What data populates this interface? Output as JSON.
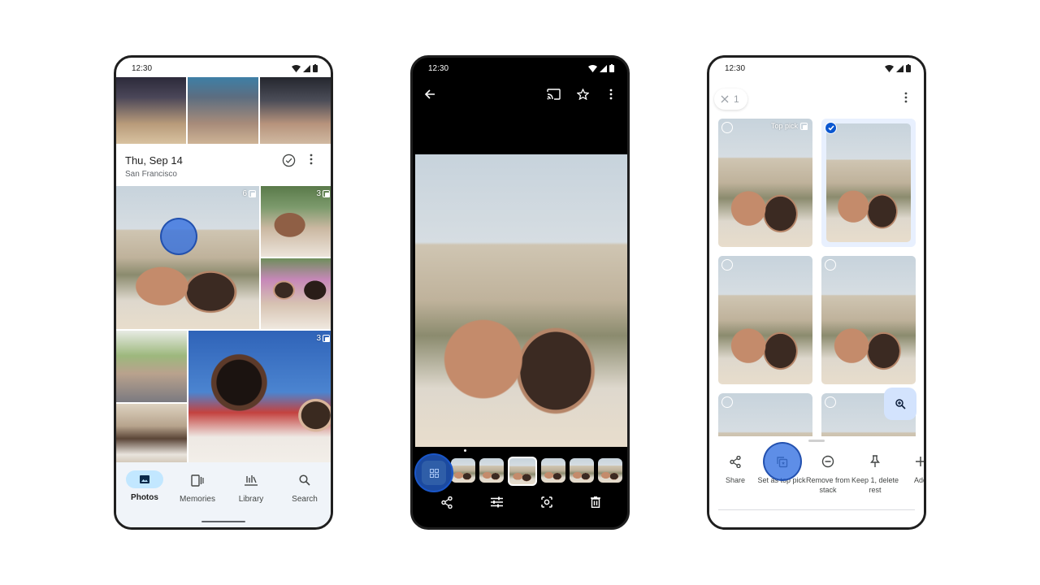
{
  "status_bar": {
    "time": "12:30"
  },
  "phone1": {
    "date_header": {
      "date": "Thu, Sep 14",
      "location": "San Francisco"
    },
    "stack_badges": [
      {
        "count": "6"
      },
      {
        "count": "3"
      },
      {
        "count": "3"
      }
    ],
    "bottom_nav": [
      {
        "label": "Photos",
        "icon": "photos-icon",
        "active": true
      },
      {
        "label": "Memories",
        "icon": "memories-icon",
        "active": false
      },
      {
        "label": "Library",
        "icon": "library-icon",
        "active": false
      },
      {
        "label": "Search",
        "icon": "search-icon",
        "active": false
      }
    ]
  },
  "phone2": {
    "top_actions": [
      "back-arrow-icon",
      "cast-icon",
      "star-icon",
      "more-vert-icon"
    ],
    "stack_thumbnails": 6,
    "current_thumbnail_index": 3,
    "bottom_actions": [
      "share-icon",
      "edit-adjust-icon",
      "lens-icon",
      "delete-icon"
    ]
  },
  "phone3": {
    "selection_count": "1",
    "top_pick_label": "Top pick",
    "grid": [
      {
        "top_pick": true,
        "selected": false
      },
      {
        "top_pick": false,
        "selected": true
      },
      {
        "top_pick": false,
        "selected": false
      },
      {
        "top_pick": false,
        "selected": false
      },
      {
        "top_pick": false,
        "selected": false
      },
      {
        "top_pick": false,
        "selected": false
      }
    ],
    "sheet_actions": [
      {
        "label": "Share",
        "icon": "share-icon"
      },
      {
        "label": "Set as top pick",
        "icon": "set-top-pick-icon"
      },
      {
        "label": "Remove from stack",
        "icon": "remove-circle-icon"
      },
      {
        "label": "Keep 1, delete rest",
        "icon": "pin-icon"
      },
      {
        "label": "Add",
        "icon": "add-icon"
      }
    ]
  },
  "colors": {
    "accent": "#0b57d0",
    "tap_indicator": "#316ee0",
    "nav_active_pill": "#c2e7ff",
    "nav_background": "#f0f4f9",
    "fab_background": "#d3e3fd"
  }
}
